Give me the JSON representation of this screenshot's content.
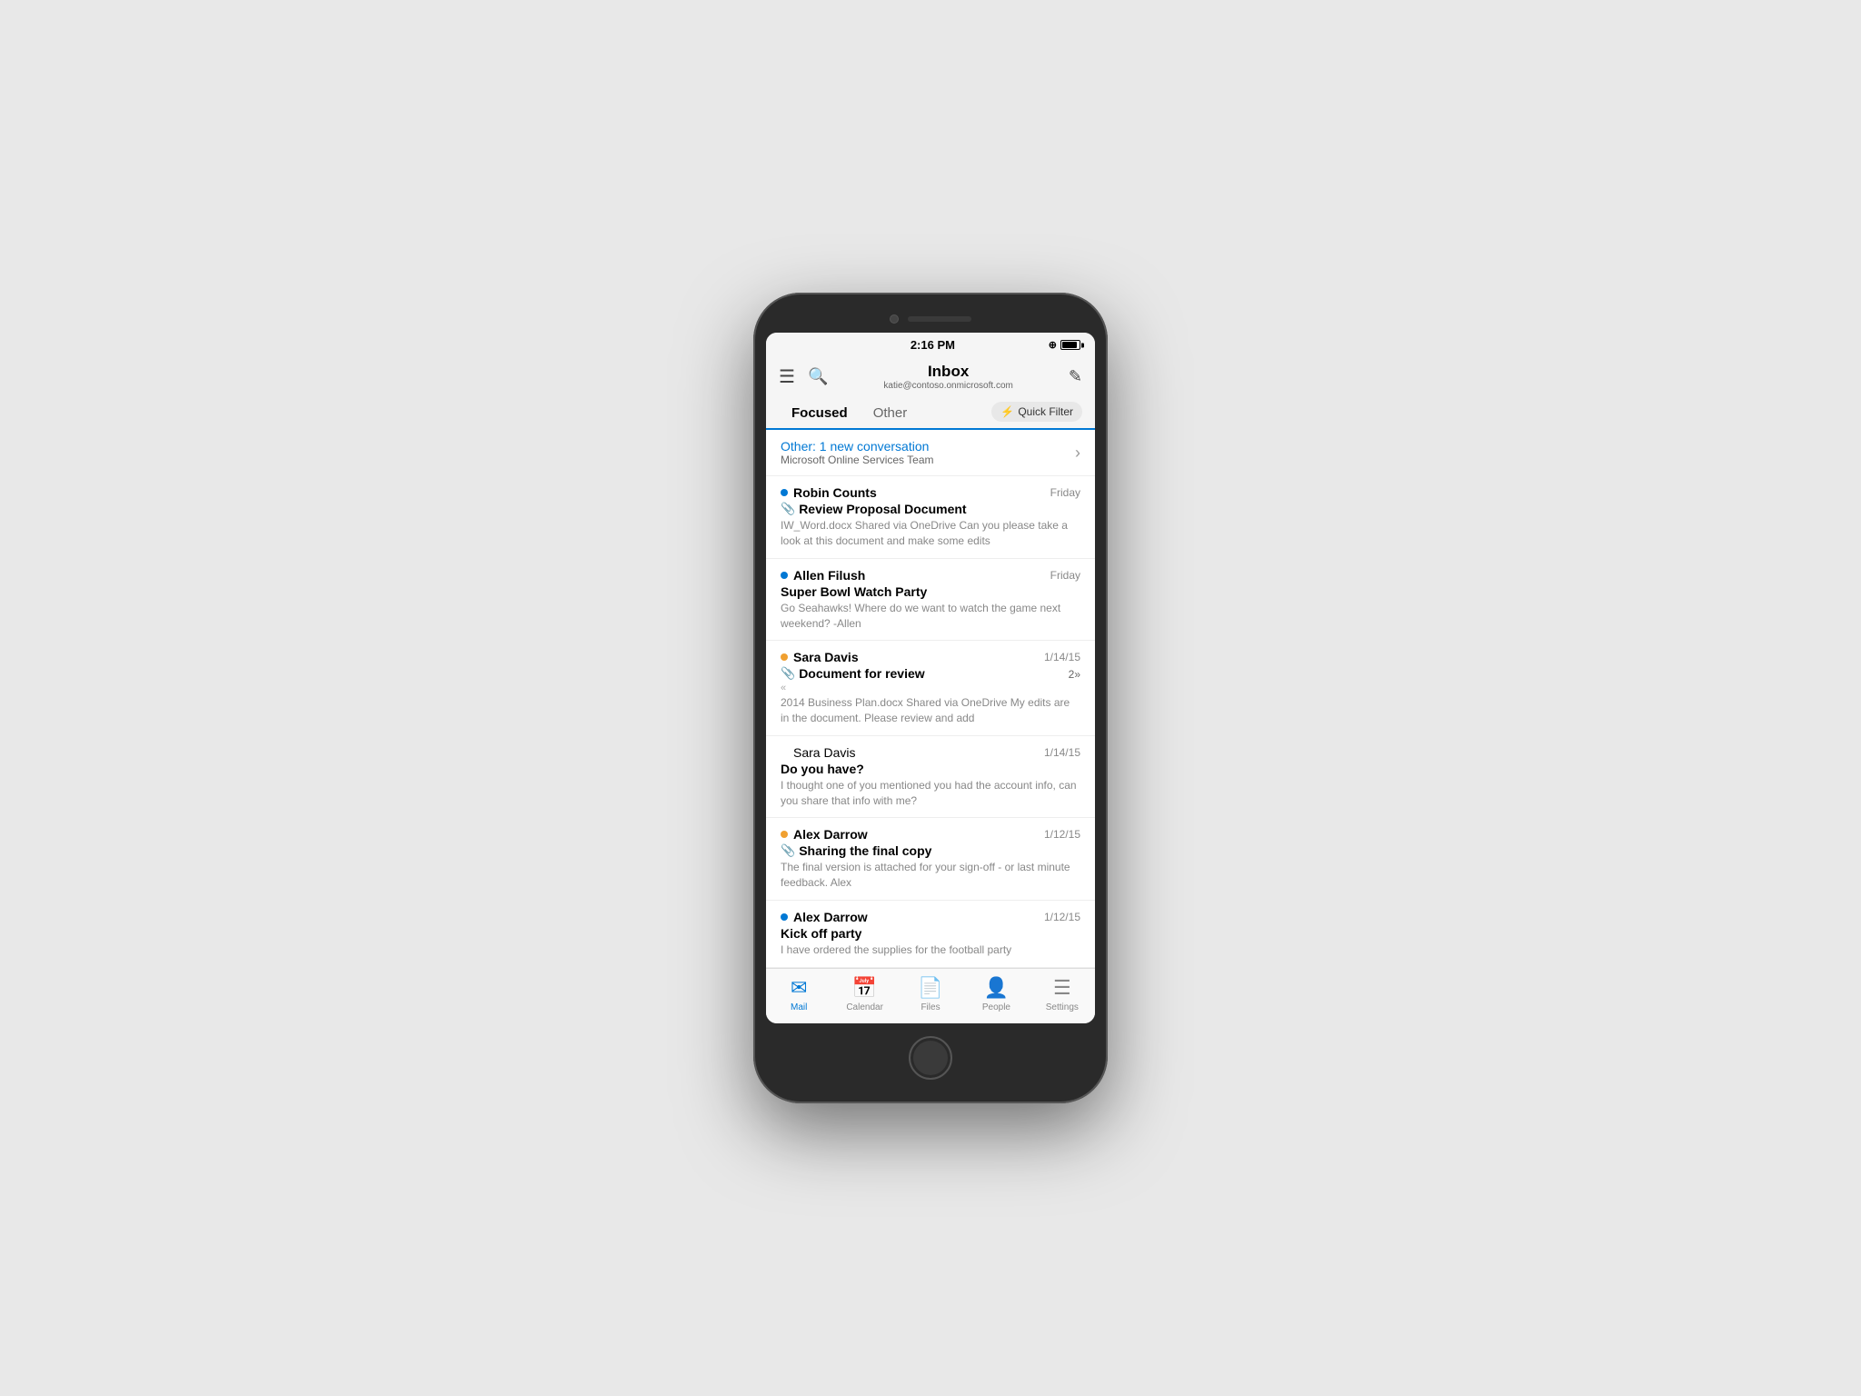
{
  "phone": {
    "status_bar": {
      "time": "2:16 PM"
    }
  },
  "header": {
    "menu_label": "☰",
    "search_label": "🔍",
    "title": "Inbox",
    "email": "katie@contoso.onmicrosoft.com",
    "compose_label": "✎"
  },
  "tabs": {
    "focused_label": "Focused",
    "other_label": "Other",
    "quick_filter_icon": "⚡",
    "quick_filter_label": "Quick Filter"
  },
  "other_banner": {
    "text": "Other: 1 new conversation",
    "sub_text": "Microsoft Online Services Team"
  },
  "emails": [
    {
      "sender": "Robin Counts",
      "date": "Friday",
      "subject": "Review Proposal Document",
      "preview": "IW_Word.docx Shared via OneDrive Can you please take a look at this document and make some edits",
      "unread": true,
      "dot_color": "blue",
      "has_attachment": true,
      "has_forward": false,
      "count": ""
    },
    {
      "sender": "Allen Filush",
      "date": "Friday",
      "subject": "Super Bowl Watch Party",
      "preview": "Go Seahawks! Where do we want to watch the game next weekend? -Allen",
      "unread": true,
      "dot_color": "blue",
      "has_attachment": false,
      "has_forward": false,
      "count": ""
    },
    {
      "sender": "Sara Davis",
      "date": "1/14/15",
      "subject": "Document for review",
      "preview": "2014 Business Plan.docx Shared via OneDrive  My edits are in the document. Please review and add",
      "unread": true,
      "dot_color": "orange",
      "has_attachment": true,
      "has_forward": false,
      "count": "2»"
    },
    {
      "sender": "Sara Davis",
      "date": "1/14/15",
      "subject": "Do you have?",
      "preview": "I thought one of you mentioned you had the account info, can you share that info with me?",
      "unread": false,
      "dot_color": "",
      "has_attachment": false,
      "has_forward": false,
      "count": ""
    },
    {
      "sender": "Alex Darrow",
      "date": "1/12/15",
      "subject": "Sharing the final copy",
      "preview": "The final version is attached for your sign-off - or last minute feedback. Alex",
      "unread": true,
      "dot_color": "orange",
      "has_attachment": true,
      "has_forward": false,
      "count": ""
    },
    {
      "sender": "Alex Darrow",
      "date": "1/12/15",
      "subject": "Kick off party",
      "preview": "I have ordered the supplies for the football party",
      "unread": true,
      "dot_color": "blue",
      "has_attachment": false,
      "has_forward": false,
      "count": ""
    }
  ],
  "nav": {
    "mail_label": "Mail",
    "calendar_label": "Calendar",
    "files_label": "Files",
    "people_label": "People",
    "settings_label": "Settings"
  }
}
